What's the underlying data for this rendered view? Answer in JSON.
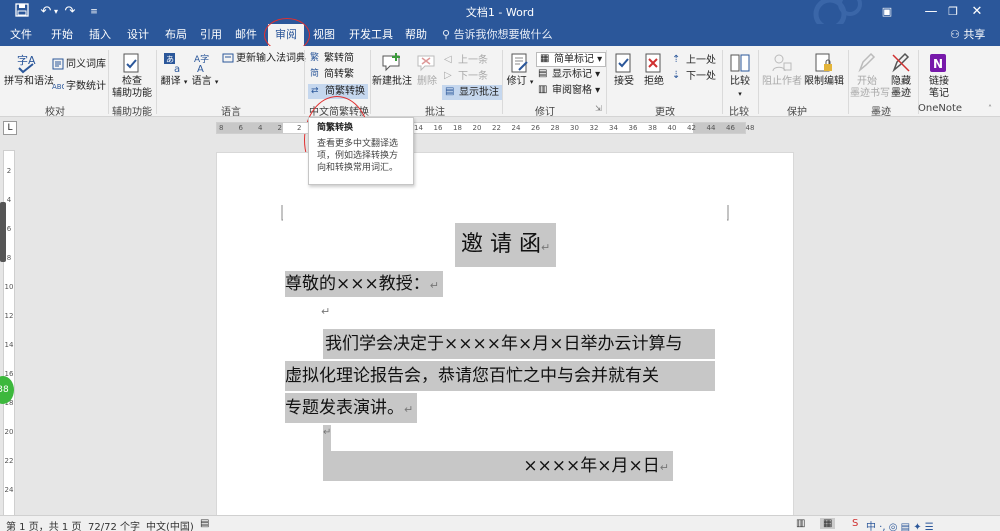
{
  "titlebar": {
    "title": "文档1 - Word",
    "save_icon": "save-icon",
    "undo_icon": "undo-icon",
    "redo_icon": "redo-icon",
    "customize_icon": "customize-icon",
    "ribbon_options_icon": "ribbon-display-icon",
    "minimize": "—",
    "restore": "❐",
    "close": "✕"
  },
  "tabs": [
    {
      "label": "文件"
    },
    {
      "label": "开始"
    },
    {
      "label": "插入"
    },
    {
      "label": "设计"
    },
    {
      "label": "布局"
    },
    {
      "label": "引用"
    },
    {
      "label": "邮件"
    },
    {
      "label": "审阅"
    },
    {
      "label": "视图"
    },
    {
      "label": "开发工具"
    },
    {
      "label": "帮助"
    }
  ],
  "tellme": "告诉我你想要做什么",
  "share": "共享",
  "ribbon": {
    "proofing": {
      "label": "校对",
      "spelling": "拼写和语法",
      "thesaurus": "同义词库",
      "wordcount": "字数统计"
    },
    "accessibility": {
      "label": "辅助功能",
      "check_line1": "检查",
      "check_line2": "辅助功能"
    },
    "language": {
      "label": "语言",
      "translate": "翻译",
      "language": "语言",
      "update_ime": "更新输入法词典"
    },
    "chinese": {
      "label": "中文简繁转换",
      "to_simplified": "繁转简",
      "to_traditional": "简转繁",
      "convert": "简繁转换"
    },
    "comments": {
      "label": "批注",
      "new": "新建批注",
      "delete": "删除",
      "prev": "上一条",
      "next": "下一条",
      "show": "显示批注"
    },
    "tracking": {
      "label": "修订",
      "track": "修订",
      "markup": "简单标记",
      "show_markup": "显示标记",
      "pane": "审阅窗格"
    },
    "changes": {
      "label": "更改",
      "accept": "接受",
      "reject": "拒绝",
      "prev": "上一处",
      "next": "下一处"
    },
    "compare": {
      "label": "比较",
      "compare": "比较"
    },
    "protect": {
      "label": "保护",
      "block": "阻止作者",
      "restrict": "限制编辑"
    },
    "ink": {
      "label": "墨迹",
      "start_line1": "开始",
      "start_line2": "墨迹书写",
      "hide_line1": "隐藏",
      "hide_line2": "墨迹"
    },
    "onenote": {
      "label": "OneNote",
      "linked_line1": "链接",
      "linked_line2": "笔记"
    }
  },
  "tooltip": {
    "title": "简繁转换",
    "body": "查看更多中文翻译选项，例如选择转换方向和转换常用词汇。"
  },
  "ruler": {
    "h_numbers": [
      "8",
      "6",
      "4",
      "2",
      "2",
      "4",
      "6",
      "8",
      "10",
      "12",
      "14",
      "16",
      "18",
      "20",
      "22",
      "24",
      "26",
      "28",
      "30",
      "32",
      "34",
      "36",
      "38",
      "40",
      "42",
      "44",
      "46",
      "48"
    ],
    "v_numbers": [
      "2",
      "4",
      "6",
      "8",
      "10",
      "12",
      "14",
      "16",
      "18",
      "20",
      "22",
      "24"
    ],
    "corner": "L"
  },
  "document": {
    "title": "邀 请 函",
    "salutation": "尊敬的×××教授：",
    "body_line1": "我们学会决定于××××年×月×日举办云计算与",
    "body_line2": "虚拟化理论报告会，恭请您百忙之中与会并就有关",
    "body_line3": "专题发表演讲。",
    "date": "××××年×月×日",
    "para_mark": "↵"
  },
  "statusbar": {
    "page": "第 1 页，共 1 页",
    "words": "72/72 个字",
    "lang": "中文(中国)",
    "badge": "38"
  }
}
